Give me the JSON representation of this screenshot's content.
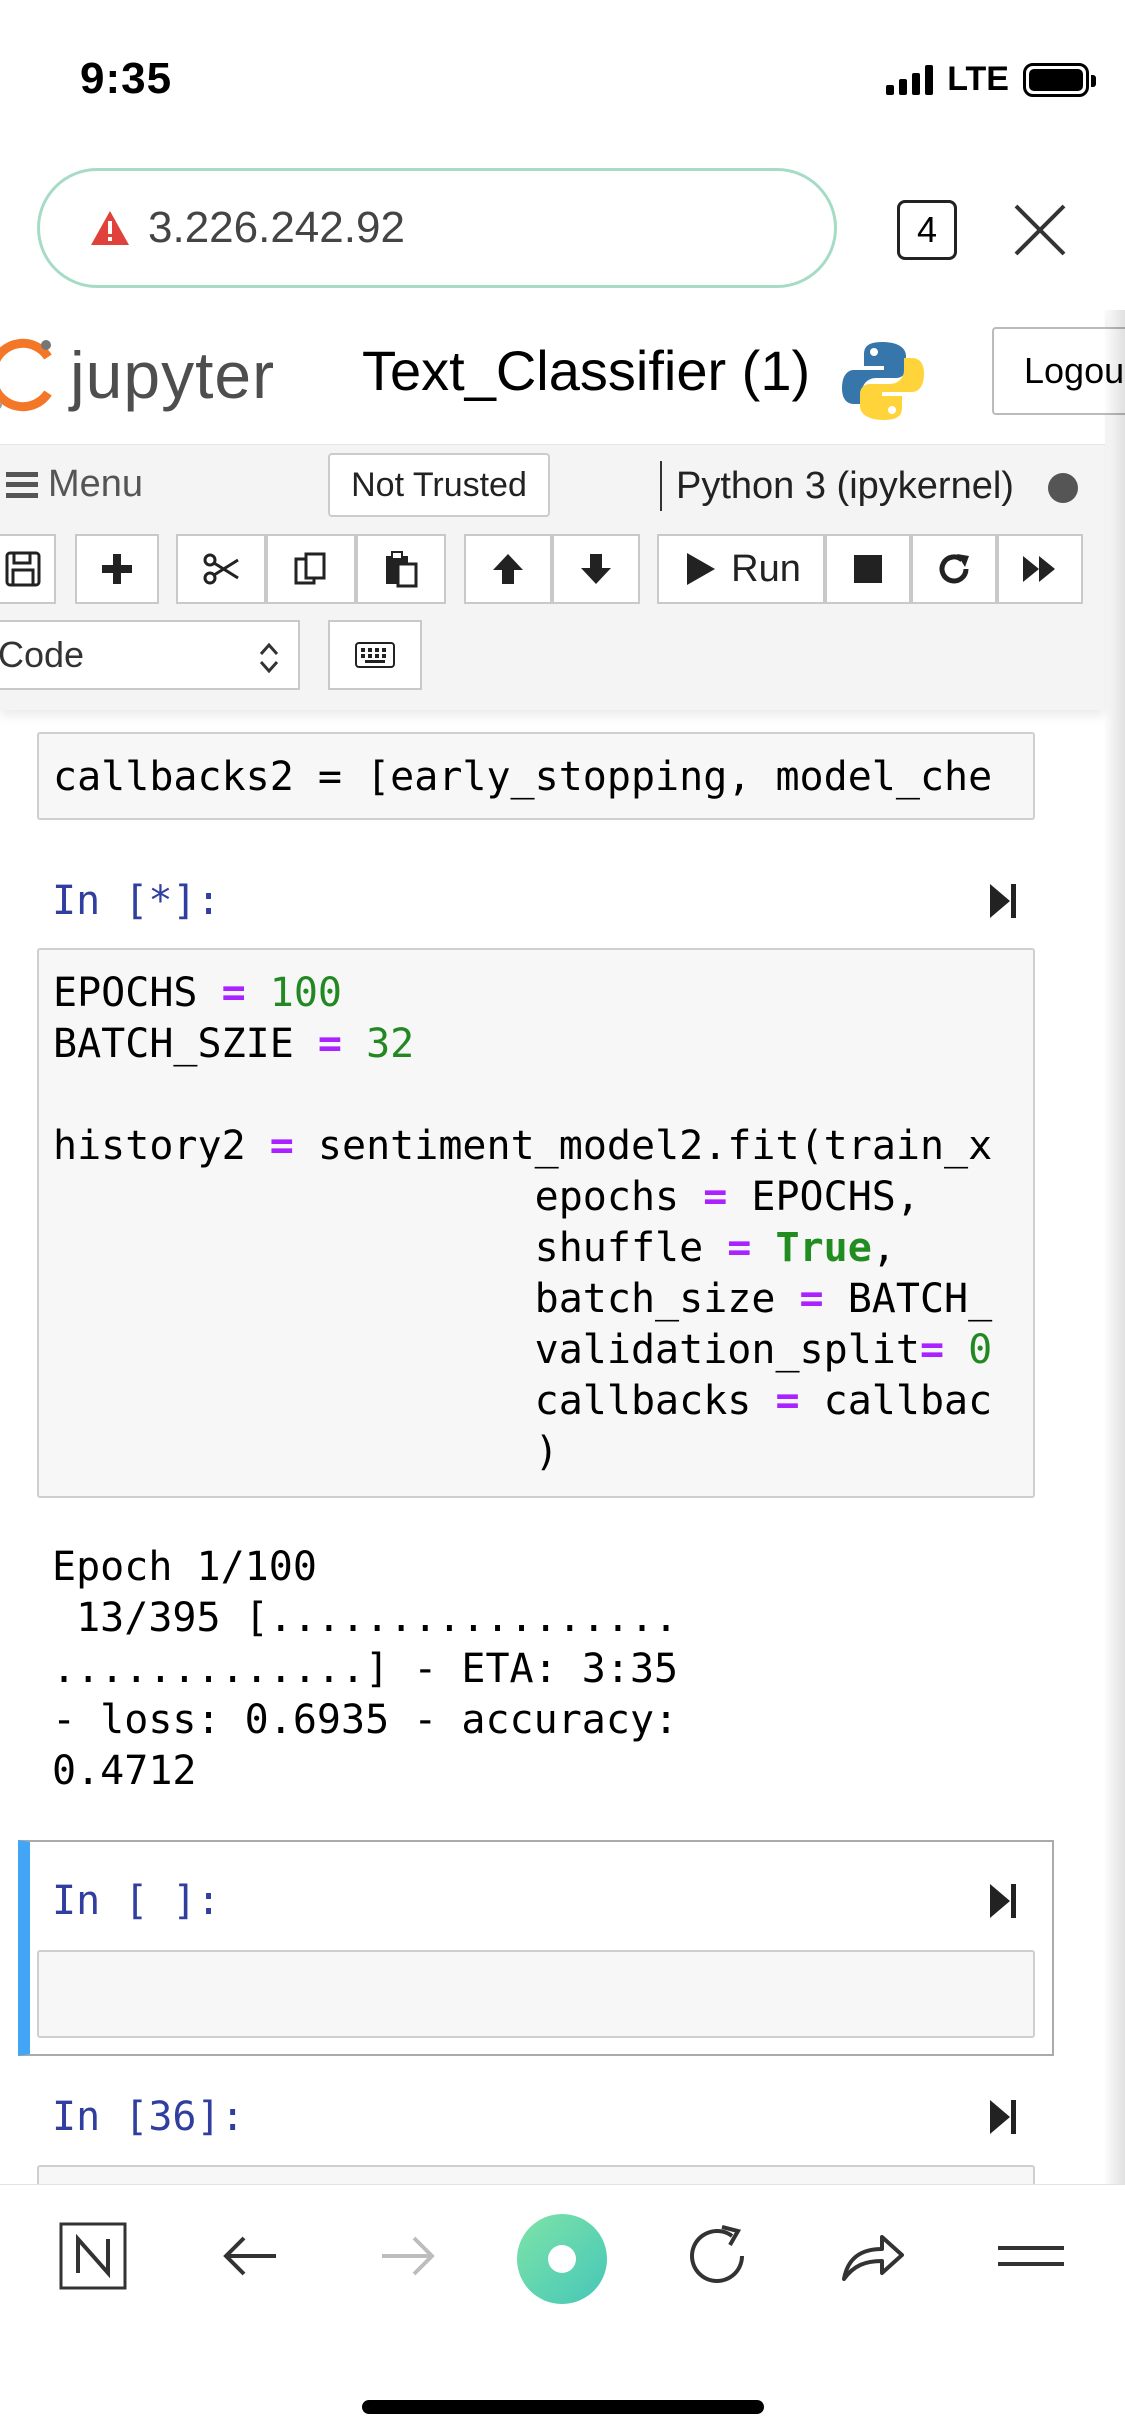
{
  "status_bar": {
    "time": "9:35",
    "network": "LTE"
  },
  "browser": {
    "url": "3.226.242.92",
    "tab_count": "4"
  },
  "jupyter": {
    "logo_text": "jupyter",
    "notebook_title": "Text_Classifier (1)",
    "logout_label": "Logou",
    "menu_label": "Menu",
    "trust_label": "Not Trusted",
    "kernel_label": "Python 3 (ipykernel)",
    "toolbar": {
      "run_label": "Run",
      "cell_type": "Code"
    }
  },
  "cells": {
    "callbacks_line": "callbacks2 = [early_stopping, model_che",
    "cell_running": {
      "prompt": "In [*]:",
      "lines": [
        "EPOCHS = 100",
        "BATCH_SZIE = 32",
        "",
        "history2 = sentiment_model2.fit(train_x",
        "                    epochs = EPOCHS,",
        "                    shuffle = True,",
        "                    batch_size = BATCH_",
        "                    validation_split= 0",
        "                    callbacks = callbac",
        "                    )"
      ],
      "output": [
        "Epoch 1/100",
        " 13/395 [.................",
        ".............] - ETA: 3:35",
        "- loss: 0.6935 - accuracy:",
        "0.4712"
      ]
    },
    "cell_empty": {
      "prompt": "In [ ]:"
    },
    "cell_next": {
      "prompt": "In [36]:"
    }
  },
  "colors": {
    "url_border": "#a6dcc6",
    "prompt_blue": "#303f9f",
    "selected_cell_bar": "#42a5f5",
    "keyword_purple": "#aa22ff",
    "number_green": "#228822",
    "home_button_green": "#5fd4a8"
  },
  "bottom_bar": {
    "icons": [
      "tabs-n-icon",
      "back-arrow-icon",
      "forward-arrow-icon",
      "home-circle-icon",
      "reload-icon",
      "share-icon",
      "menu-icon"
    ]
  }
}
